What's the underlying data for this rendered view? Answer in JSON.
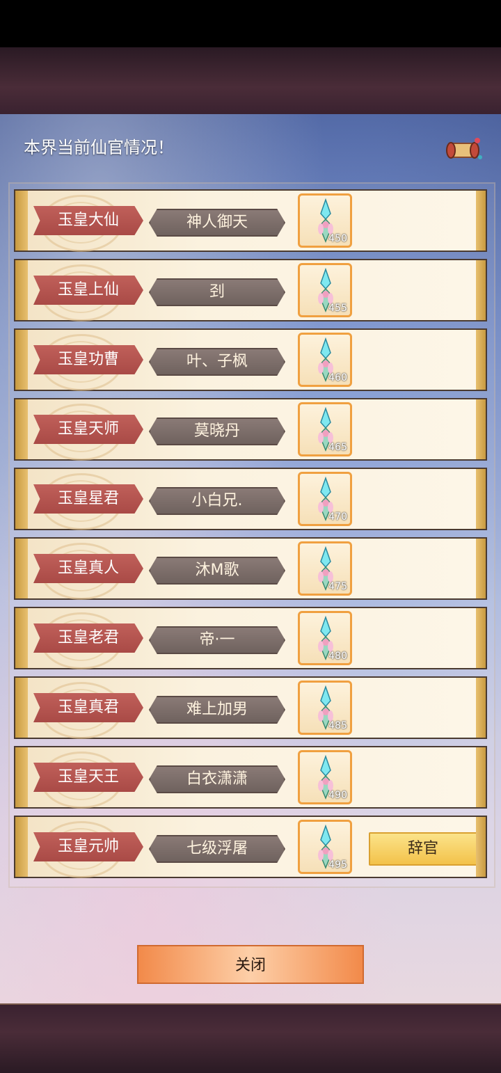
{
  "header": {
    "title": "本界当前仙官情况！"
  },
  "rows": [
    {
      "rank": "玉皇大仙",
      "player": "神人御天",
      "reward": "450"
    },
    {
      "rank": "玉皇上仙",
      "player": "刭",
      "reward": "455"
    },
    {
      "rank": "玉皇功曹",
      "player": "叶、子枫",
      "reward": "460"
    },
    {
      "rank": "玉皇天师",
      "player": "莫晓丹",
      "reward": "465"
    },
    {
      "rank": "玉皇星君",
      "player": "小白兄.",
      "reward": "470"
    },
    {
      "rank": "玉皇真人",
      "player": "沐M歌",
      "reward": "475"
    },
    {
      "rank": "玉皇老君",
      "player": "帝·一",
      "reward": "480"
    },
    {
      "rank": "玉皇真君",
      "player": "难上加男",
      "reward": "485"
    },
    {
      "rank": "玉皇天王",
      "player": "白衣潇潇",
      "reward": "490"
    },
    {
      "rank": "玉皇元帅",
      "player": "七级浮屠",
      "reward": "495",
      "action": "辞官"
    }
  ],
  "footer": {
    "close_label": "关闭"
  }
}
